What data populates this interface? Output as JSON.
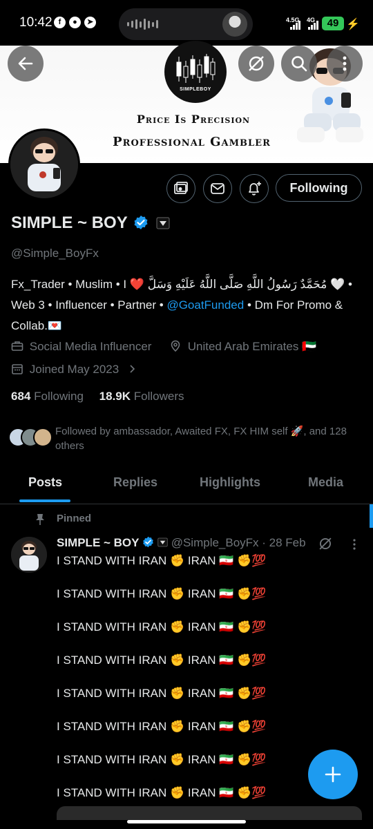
{
  "status_bar": {
    "time": "10:42",
    "net_left": "4.5G",
    "net_right": "4G",
    "battery": "49"
  },
  "banner": {
    "logo_text": "SIMPLEBOY",
    "tagline_1": "Price Is Precision",
    "tagline_2": "Professional Gambler"
  },
  "profile": {
    "name": "SIMPLE ~ BOY",
    "handle": "@Simple_BoyFx",
    "bio_part1": "Fx_Trader • Muslim • I ❤️ مُحَمَّدٌ رَسُولُ اللَّهِ صَلَّى اللَّهُ عَلَيْهِ وَسَلَّ 🤍 • Web 3 •  Influencer • Partner • ",
    "bio_link": "@GoatFunded",
    "bio_part2": " • Dm For Promo & Collab.💌",
    "category": "Social Media Influencer",
    "location": "United Arab Emirates 🇦🇪",
    "joined": "Joined May 2023",
    "following_count": "684",
    "following_label": "Following",
    "followers_count": "18.9K",
    "followers_label": "Followers",
    "followed_by": "Followed by ambassador, Awaited FX, FX HIM self 🚀, and 128 others",
    "follow_button": "Following"
  },
  "tabs": [
    "Posts",
    "Replies",
    "Highlights",
    "Media"
  ],
  "post": {
    "pinned_label": "Pinned",
    "author": "SIMPLE ~ BOY",
    "handle_date": "@Simple_BoyFx · 28 Feb",
    "lines": [
      "I STAND WITH IRAN ✊ IRAN 🇮🇷 ✊💯",
      "I STAND WITH IRAN ✊ IRAN 🇮🇷 ✊💯",
      "I STAND WITH IRAN ✊ IRAN 🇮🇷 ✊💯",
      "I STAND WITH IRAN ✊ IRAN 🇮🇷 ✊💯",
      "I STAND WITH IRAN ✊ IRAN 🇮🇷 ✊💯",
      "I STAND WITH IRAN ✊ IRAN 🇮🇷 ✊💯",
      "I STAND WITH IRAN ✊ IRAN 🇮🇷 ✊💯",
      "I STAND WITH IRAN ✊ IRAN 🇮🇷 ✊💯"
    ]
  },
  "colors": {
    "accent": "#1d9bf0",
    "muted": "#71767b",
    "text": "#e7e9ea",
    "battery": "#34c759"
  },
  "icons": [
    "back-arrow-icon",
    "grok-icon",
    "search-icon",
    "more-icon",
    "subscribe-icon",
    "message-icon",
    "bell-plus-icon",
    "verified-icon",
    "briefcase-icon",
    "location-icon",
    "calendar-icon",
    "chevron-right-icon",
    "pin-icon",
    "compose-icon"
  ]
}
